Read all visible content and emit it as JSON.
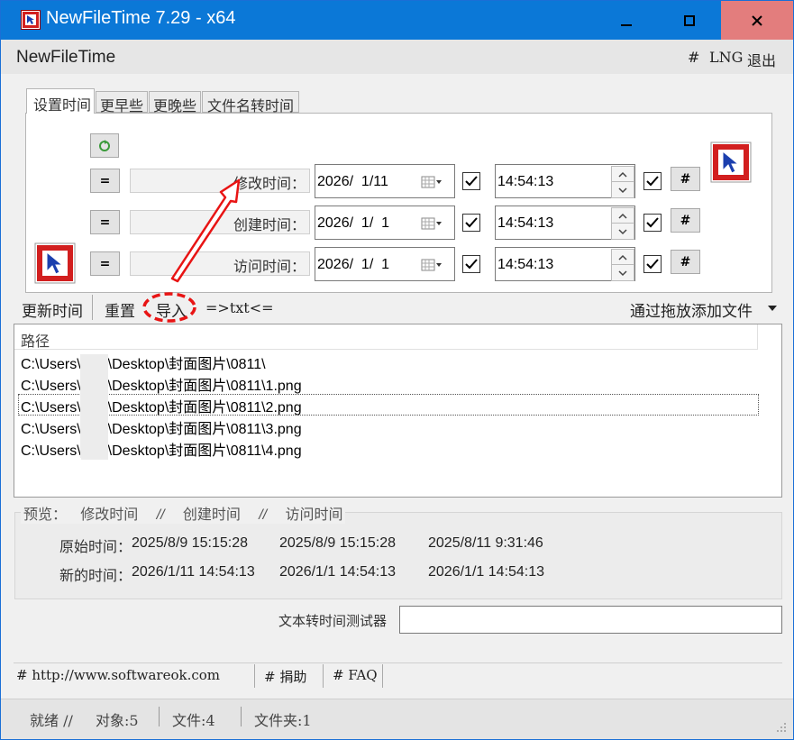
{
  "window": {
    "title": "NewFileTime 7.29 - x64"
  },
  "appbar": {
    "name": "NewFileTime",
    "hash": "#",
    "lng": "LNG",
    "exit": "退出"
  },
  "tabs": [
    {
      "label": "设置时间"
    },
    {
      "label": "更早些"
    },
    {
      "label": "更晚些"
    },
    {
      "label": "文件名转时间"
    }
  ],
  "time_rows": [
    {
      "eq": "=",
      "label": "修改时间：",
      "date": "2026/  1/11",
      "time": "14:54:13",
      "hash": "#"
    },
    {
      "eq": "=",
      "label": "创建时间：",
      "date": "2026/  1/  1",
      "time": "14:54:13",
      "hash": "#"
    },
    {
      "eq": "=",
      "label": "访问时间：",
      "date": "2026/  1/  1",
      "time": "14:54:13",
      "hash": "#"
    }
  ],
  "toolbar": {
    "update": "更新时间",
    "reset": "重置",
    "import": "导入",
    "txt": "=>txt<=",
    "drag": "通过拖放添加文件"
  },
  "files": {
    "header": "路径",
    "rows": [
      {
        "prefix": "C:\\Users\\",
        "suffix": "\\Desktop\\封面图片\\0811\\"
      },
      {
        "prefix": "C:\\Users\\",
        "suffix": "\\Desktop\\封面图片\\0811\\1.png"
      },
      {
        "prefix": "C:\\Users\\",
        "suffix": "\\Desktop\\封面图片\\0811\\2.png"
      },
      {
        "prefix": "C:\\Users\\",
        "suffix": "\\Desktop\\封面图片\\0811\\3.png"
      },
      {
        "prefix": "C:\\Users\\",
        "suffix": "\\Desktop\\封面图片\\0811\\4.png"
      }
    ]
  },
  "preview": {
    "label": "预览：",
    "modified": "修改时间",
    "sep": "//",
    "created": "创建时间",
    "accessed": "访问时间",
    "orig_label": "原始时间：",
    "orig": [
      "2025/8/9 15:15:28",
      "2025/8/9 15:15:28",
      "2025/8/11 9:31:46"
    ],
    "new_label": "新的时间：",
    "new": [
      "2026/1/11 14:54:13",
      "2026/1/1 14:54:13",
      "2026/1/1 14:54:13"
    ]
  },
  "tester": {
    "label": "文本转时间测试器",
    "value": ""
  },
  "links": {
    "website": "# http://www.softwareok.com",
    "donate": "# 捐助",
    "faq": "# FAQ"
  },
  "status": {
    "ready": "就绪 //",
    "objects": "对象:5",
    "files": "文件:4",
    "folders": "文件夹:1"
  },
  "colors": {
    "titlebar": "#0b78d7",
    "close_hover": "#e81123",
    "annotation": "#e81414"
  }
}
